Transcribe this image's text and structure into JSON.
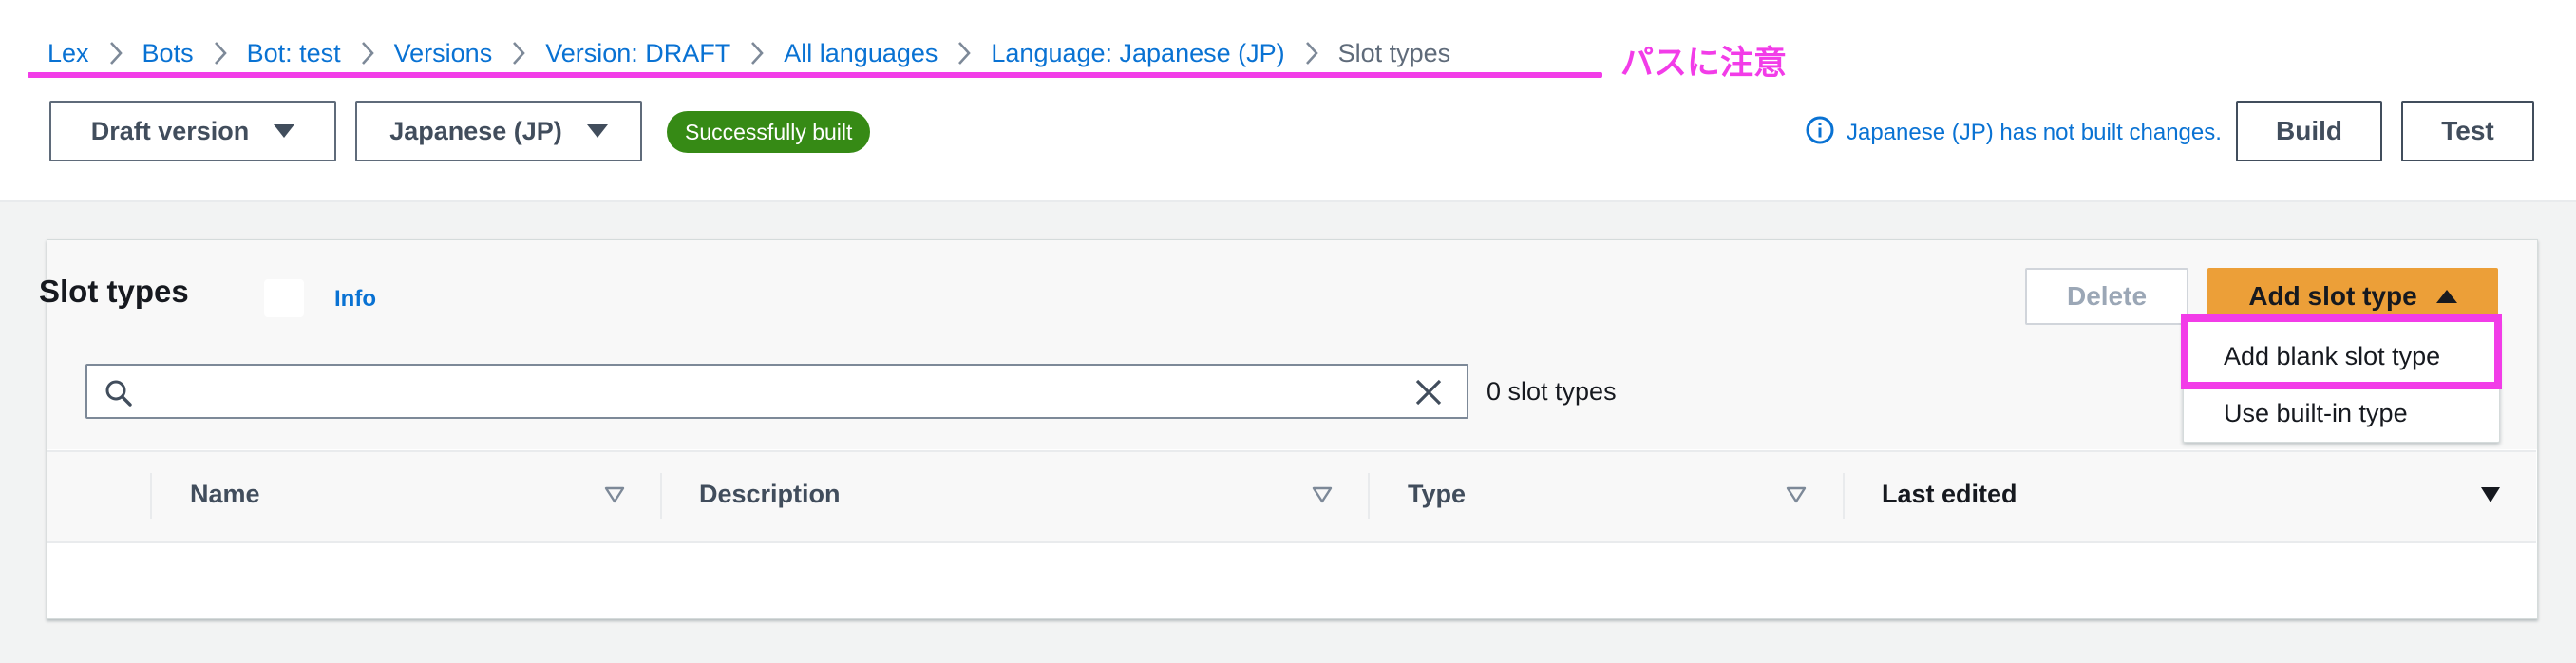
{
  "breadcrumb": {
    "items": [
      {
        "label": "Lex"
      },
      {
        "label": "Bots"
      },
      {
        "label": "Bot: test"
      },
      {
        "label": "Versions"
      },
      {
        "label": "Version: DRAFT"
      },
      {
        "label": "All languages"
      },
      {
        "label": "Language: Japanese (JP)"
      },
      {
        "label": "Slot types"
      }
    ]
  },
  "annotation": {
    "text": "パスに注意",
    "color": "#f23ce8"
  },
  "toolbar": {
    "version_select": "Draft version",
    "language_select": "Japanese (JP)",
    "build_status": "Successfully built",
    "notice": "Japanese (JP) has not built changes.",
    "build_label": "Build",
    "test_label": "Test"
  },
  "panel": {
    "title": "Slot types",
    "info_label": "Info",
    "delete_label": "Delete",
    "add_label": "Add slot type",
    "search": {
      "value": "",
      "placeholder": ""
    },
    "count_text": "0 slot types",
    "menu": {
      "items": [
        {
          "label": "Add blank slot type"
        },
        {
          "label": "Use built-in type"
        }
      ]
    },
    "table": {
      "columns": [
        {
          "label": "Name"
        },
        {
          "label": "Description"
        },
        {
          "label": "Type"
        },
        {
          "label": "Last edited"
        }
      ],
      "rows": []
    }
  },
  "colors": {
    "link": "#0972d3",
    "primary_button": "#ec9f38",
    "success_badge": "#368a15",
    "highlight": "#f23ce8"
  },
  "icons": [
    "chevron-right-icon",
    "caret-down-icon",
    "info-icon",
    "caret-up-icon",
    "search-icon",
    "close-icon",
    "sort-icon"
  ]
}
